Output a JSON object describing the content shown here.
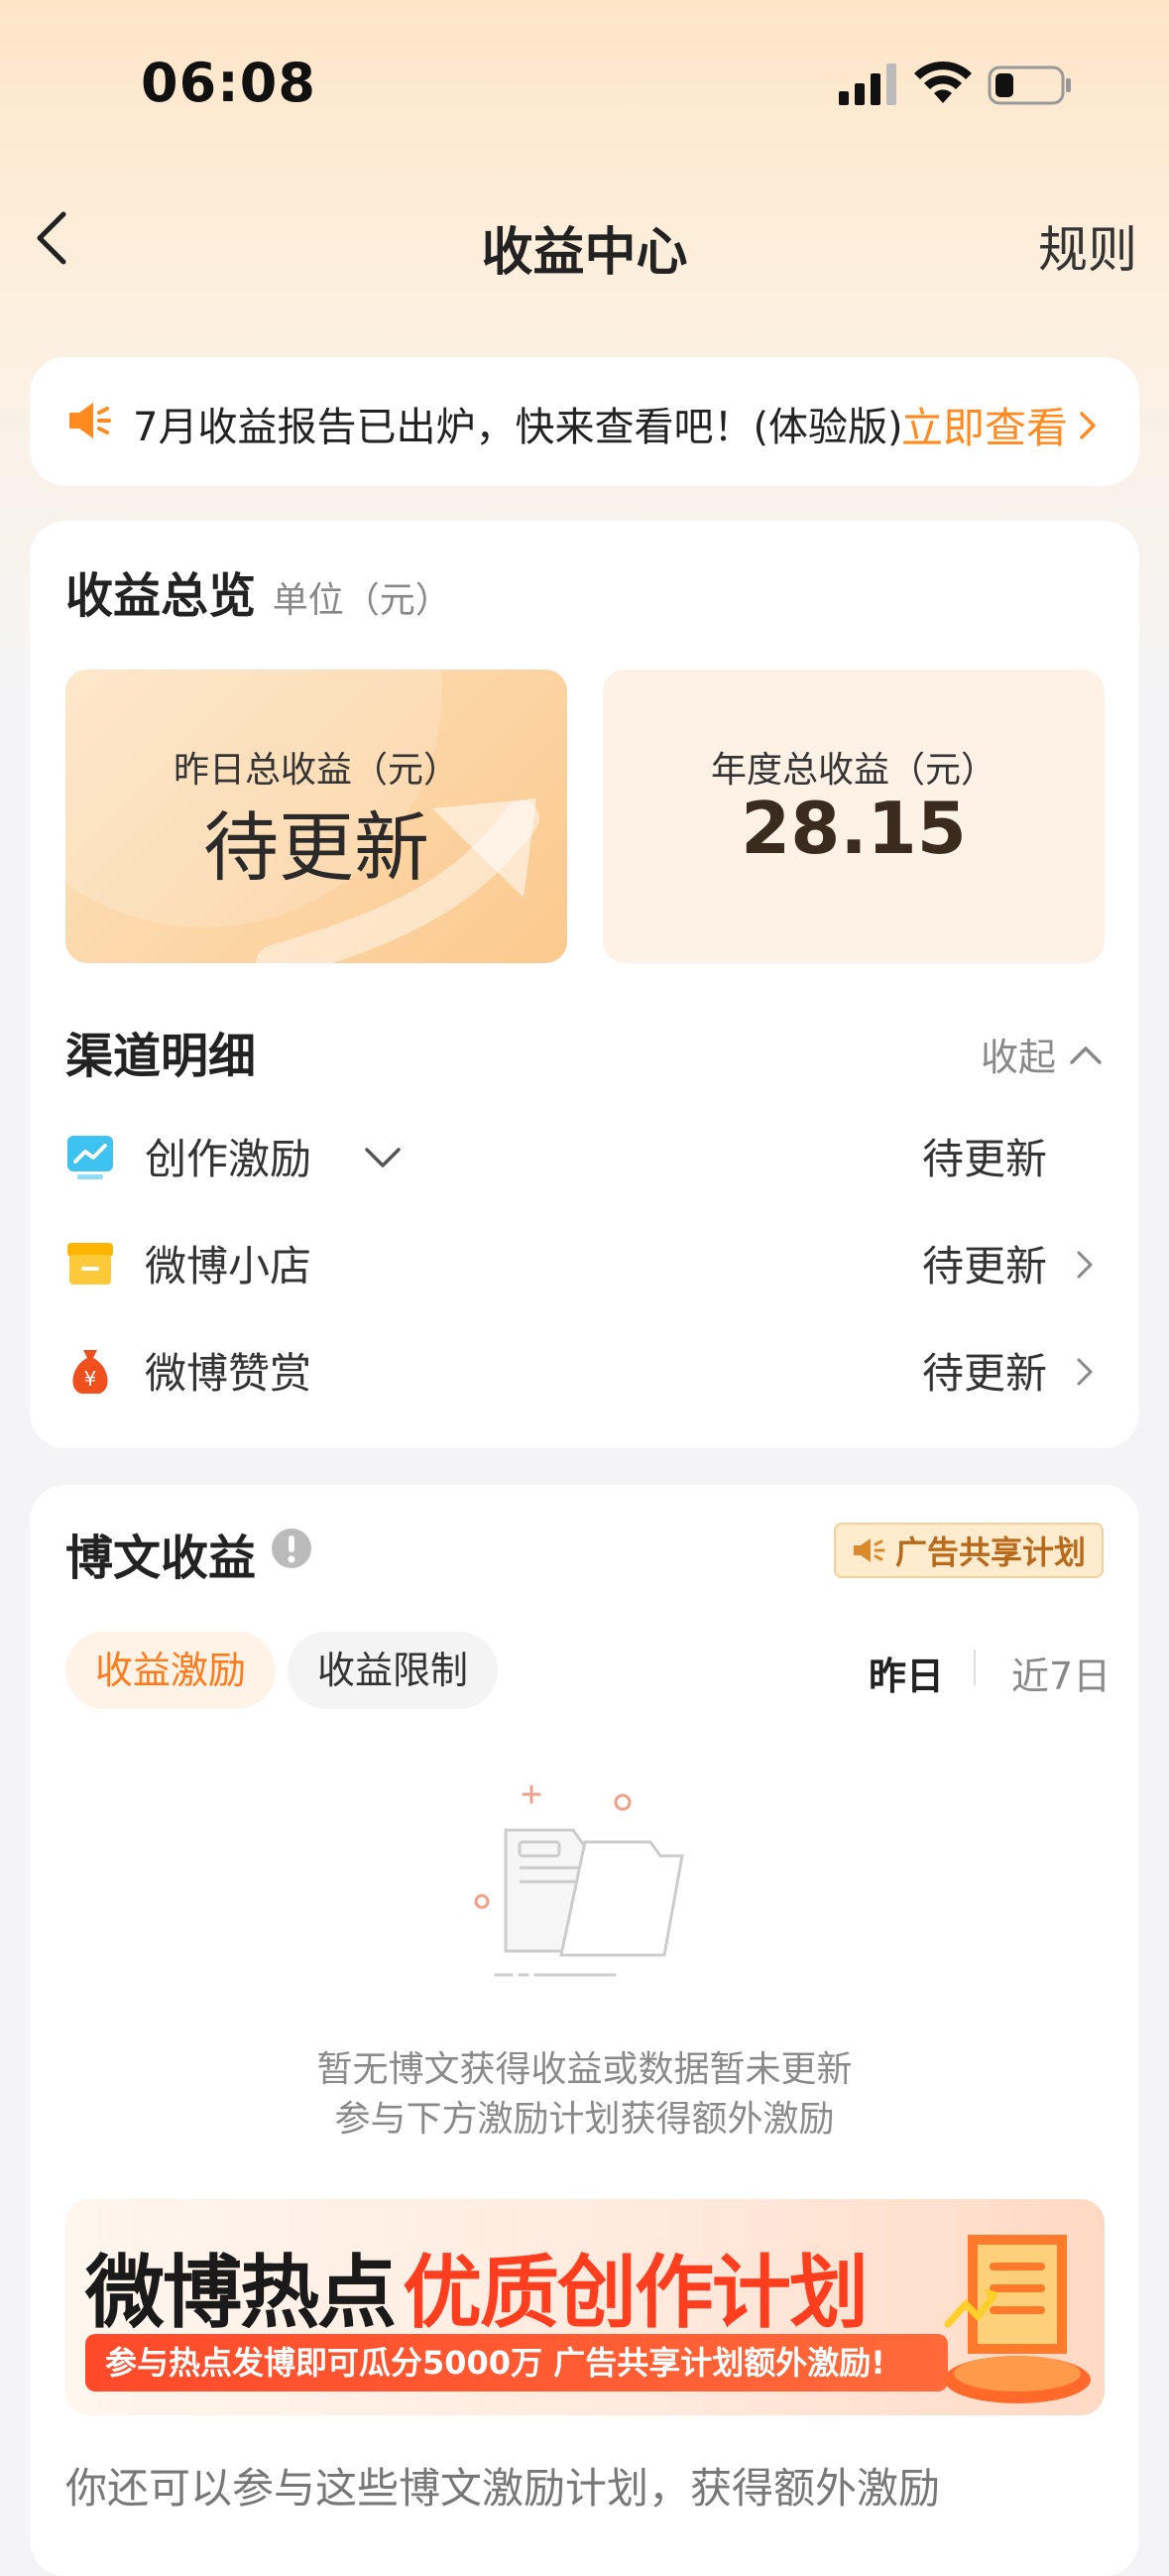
{
  "status_bar": {
    "time": "06:08"
  },
  "nav": {
    "title": "收益中心",
    "rules": "规则"
  },
  "notice": {
    "text": "7月收益报告已出炉，快来查看吧！(体验版)",
    "link": "立即查看"
  },
  "overview": {
    "title": "收益总览",
    "unit": "单位（元）",
    "yesterday": {
      "label": "昨日总收益（元）",
      "value": "待更新"
    },
    "annual": {
      "label": "年度总收益（元）",
      "value": "28.15"
    },
    "channel_title": "渠道明细",
    "collapse": "收起",
    "channels": [
      {
        "label": "创作激励",
        "value": "待更新"
      },
      {
        "label": "微博小店",
        "value": "待更新"
      },
      {
        "label": "微博赞赏",
        "value": "待更新"
      }
    ]
  },
  "post": {
    "title": "博文收益",
    "badge": "广告共享计划",
    "tabs": [
      "收益激励",
      "收益限制"
    ],
    "periods": [
      "昨日",
      "近7日"
    ],
    "empty_line1": "暂无博文获得收益或数据暂未更新",
    "empty_line2": "参与下方激励计划获得额外激励",
    "banner": {
      "title_black": "微博热点",
      "title_red": "优质创作计划",
      "strip": "参与热点发博即可瓜分5000万 广告共享计划额外激励!"
    },
    "bottom_text": "你还可以参与这些博文激励计划，获得额外激励"
  },
  "colors": {
    "accent": "#ff8a1f",
    "banner_red": "#ff3d1f"
  }
}
